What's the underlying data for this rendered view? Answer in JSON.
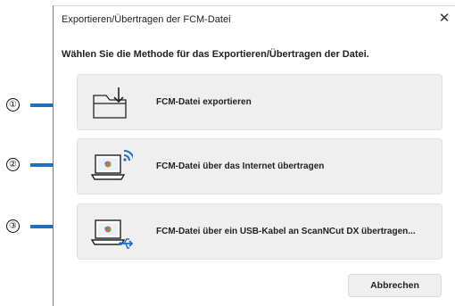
{
  "window": {
    "title": "Exportieren/Übertragen der FCM-Datei",
    "close_symbol": "✕"
  },
  "instruction": "Wählen Sie die Methode für das Exportieren/Übertragen der Datei.",
  "options": [
    {
      "label": "FCM-Datei exportieren",
      "icon": "folder-export-icon"
    },
    {
      "label": "FCM-Datei über das Internet übertragen",
      "icon": "laptop-wireless-icon"
    },
    {
      "label": "FCM-Datei über ein USB-Kabel an ScanNCut DX übertragen...",
      "icon": "laptop-usb-icon"
    }
  ],
  "cancel_label": "Abbrechen",
  "callouts": [
    "①",
    "②",
    "③"
  ],
  "colors": {
    "accent": "#1f6fc2",
    "option_bg": "#efefef"
  }
}
